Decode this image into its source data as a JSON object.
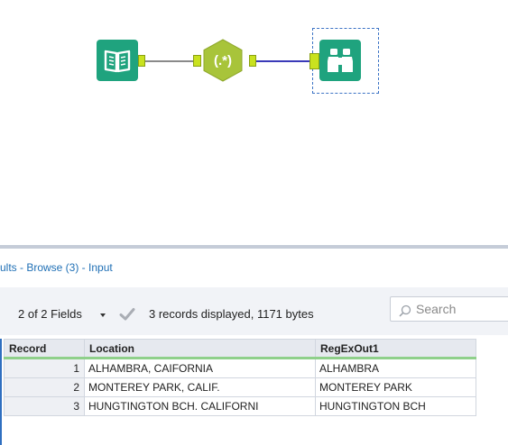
{
  "workflow": {
    "tools": [
      {
        "name": "input-data",
        "icon": "book-icon"
      },
      {
        "name": "regex",
        "icon": "regex-icon",
        "glyph": "(.*)"
      },
      {
        "name": "browse",
        "icon": "binoculars-icon"
      }
    ],
    "colors": {
      "tool_green": "#1fa37e",
      "regex_hex": "#a8c43a",
      "anchor": "#c9e21f",
      "connection_selected": "#3a3ab8"
    }
  },
  "results": {
    "title": "ults - Browse (3) - Input",
    "fields_selector": "2 of 2 Fields",
    "records_info": "3 records displayed, 1171 bytes",
    "search": {
      "placeholder": "Search"
    },
    "columns": [
      "Record",
      "Location",
      "RegExOut1"
    ],
    "rows": [
      {
        "record": "1",
        "location": "ALHAMBRA, CAIFORNIA",
        "regex_out": "ALHAMBRA"
      },
      {
        "record": "2",
        "location": "MONTEREY PARK, CALIF.",
        "regex_out": "MONTEREY PARK"
      },
      {
        "record": "3",
        "location": "HUNGTINGTON BCH. CALIFORNI",
        "regex_out": "HUNGTINGTON BCH"
      }
    ]
  }
}
